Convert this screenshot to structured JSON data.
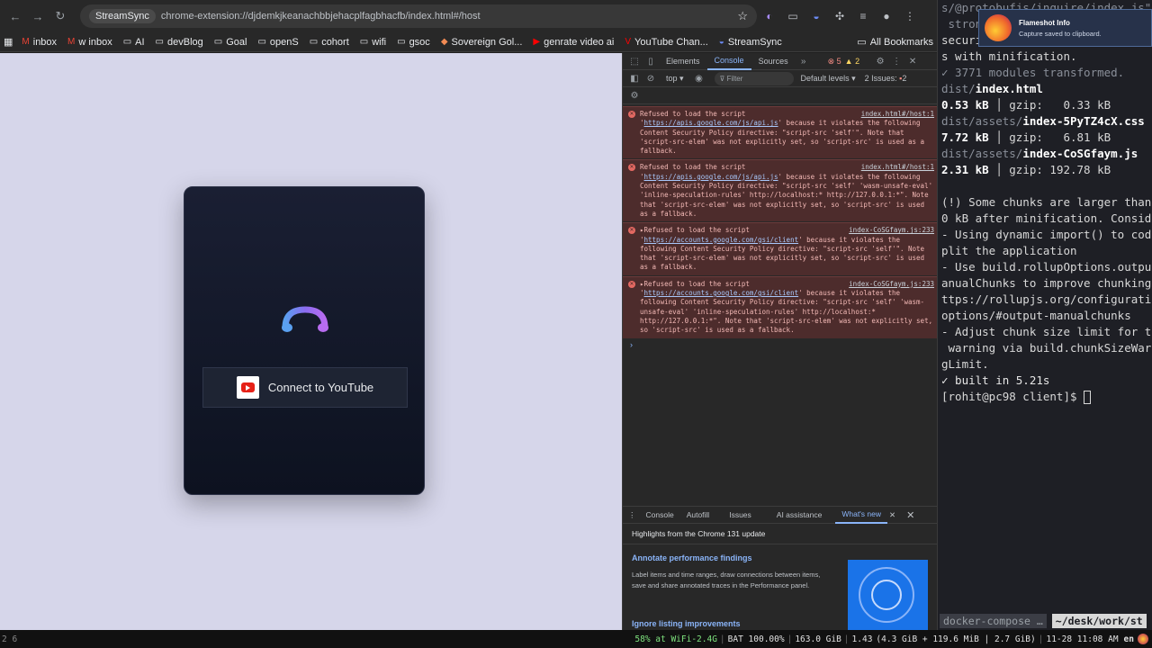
{
  "browser": {
    "tab_chip": "StreamSync",
    "url": "chrome-extension://djdemkjkeanachbbjehacplfagbhacfb/index.html#/host",
    "bookmarks": [
      {
        "icon": "gmail-icon",
        "label": "inbox"
      },
      {
        "icon": "gmail-icon",
        "label": "w inbox"
      },
      {
        "icon": "folder-icon",
        "label": "AI"
      },
      {
        "icon": "folder-icon",
        "label": "devBlog"
      },
      {
        "icon": "folder-icon",
        "label": "Goal"
      },
      {
        "icon": "folder-icon",
        "label": "openS"
      },
      {
        "icon": "folder-icon",
        "label": "cohort"
      },
      {
        "icon": "folder-icon",
        "label": "wifi"
      },
      {
        "icon": "folder-icon",
        "label": "gsoc"
      },
      {
        "icon": "sovereign-icon",
        "label": "Sovereign Gol..."
      },
      {
        "icon": "youtube-icon",
        "label": "genrate video ai"
      },
      {
        "icon": "youtube-icon",
        "label": "YouTube Chan..."
      },
      {
        "icon": "streamsync-icon",
        "label": "StreamSync"
      }
    ],
    "all_bookmarks": "All Bookmarks"
  },
  "app": {
    "connect_label": "Connect to YouTube",
    "page_bg": "#d6d6ea"
  },
  "devtools": {
    "tabs": [
      "Elements",
      "Console",
      "Sources"
    ],
    "active_tab": "Console",
    "error_count": "5",
    "warn_count": "2",
    "context": "top",
    "filter_placeholder": "Filter",
    "levels": "Default levels",
    "issues": "2 Issues:",
    "issues_count": "2",
    "errors": [
      {
        "src": "index.html#/host:1",
        "pre": "Refused to load the script '",
        "link": "https://apis.google.com/js/api.js",
        "post": "' because it violates the following Content Security Policy directive: \"script-src 'self'\". Note that 'script-src-elem' was not explicitly set, so 'script-src' is used as a fallback."
      },
      {
        "src": "index.html#/host:1",
        "pre": "Refused to load the script '",
        "link": "https://apis.google.com/js/api.js",
        "post": "' because it violates the following Content Security Policy directive: \"script-src 'self' 'wasm-unsafe-eval' 'inline-speculation-rules' http://localhost:* http://127.0.0.1:*\". Note that 'script-src-elem' was not explicitly set, so 'script-src' is used as a fallback."
      },
      {
        "src": "index-CoSGfaym.js:233",
        "pre": "▸Refused to load the script '",
        "link": "https://accounts.google.com/gsi/client",
        "post": "' because it violates the following Content Security Policy directive: \"script-src 'self'\". Note that 'script-src-elem' was not explicitly set, so 'script-src' is used as a fallback."
      },
      {
        "src": "index-CoSGfaym.js:233",
        "pre": "▸Refused to load the script '",
        "link": "https://accounts.google.com/gsi/client",
        "post": "' because it violates the following Content Security Policy directive: \"script-src 'self' 'wasm-unsafe-eval' 'inline-speculation-rules' http://localhost:* http://127.0.0.1:*\". Note that 'script-src-elem' was not explicitly set, so 'script-src' is used as a fallback."
      }
    ],
    "drawer_tabs": [
      "Console",
      "Autofill",
      "Issues",
      "AI assistance",
      "What's new"
    ],
    "drawer_active": "What's new",
    "whats_new_head": "Highlights from the Chrome 131 update",
    "whats_new_title": "Annotate performance findings",
    "whats_new_desc": "Label items and time ranges, draw connections between items, save and share annotated traces in the Performance panel.",
    "whats_new_title2": "Ignore listing improvements"
  },
  "terminal": {
    "lines": [
      {
        "t": "s/@protobufjs/inquire/index.js\"",
        "cls": "dim"
      },
      {
        "t": " strongly recommended to avoid",
        "cls": "dim"
      },
      {
        "t": "security risks and problems",
        "cls": ""
      },
      {
        "t": "s with minification.",
        "cls": ""
      },
      {
        "t": "✓ 3771 modules transformed.",
        "cls": "dim"
      },
      {
        "t": "dist/index.html",
        "cls": "file"
      },
      {
        "t": "0.53 kB │ gzip:   0.33 kB",
        "cls": "size"
      },
      {
        "t": "dist/assets/index-5PyTZ4cX.css",
        "cls": "file"
      },
      {
        "t": "7.72 kB │ gzip:   6.81 kB",
        "cls": "size"
      },
      {
        "t": "dist/assets/index-CoSGfaym.js",
        "cls": "file"
      },
      {
        "t": "2.31 kB │ gzip: 192.78 kB",
        "cls": "size"
      },
      {
        "t": "",
        "cls": ""
      },
      {
        "t": "(!) Some chunks are larger than",
        "cls": ""
      },
      {
        "t": "0 kB after minification. Consid",
        "cls": ""
      },
      {
        "t": "- Using dynamic import() to cod",
        "cls": ""
      },
      {
        "t": "plit the application",
        "cls": ""
      },
      {
        "t": "- Use build.rollupOptions.outpu",
        "cls": ""
      },
      {
        "t": "anualChunks to improve chunking",
        "cls": ""
      },
      {
        "t": "ttps://rollupjs.org/configurati",
        "cls": ""
      },
      {
        "t": "options/#output-manualchunks",
        "cls": ""
      },
      {
        "t": "- Adjust chunk size limit for t",
        "cls": ""
      },
      {
        "t": " warning via build.chunkSizeWar",
        "cls": ""
      },
      {
        "t": "gLimit.",
        "cls": ""
      },
      {
        "t": "✓ built in 5.21s",
        "cls": "ok"
      }
    ],
    "prompt": "[rohit@pc98 client]$ ",
    "pane1": "docker-compose …",
    "pane2": "~/desk/work/st"
  },
  "notification": {
    "title": "Flameshot Info",
    "body": "Capture saved to clipboard."
  },
  "statusbar": {
    "workspaces": "2 6",
    "wifi": "58% at WiFi-2.4G",
    "battery": "BAT 100.00%",
    "disk": "163.0 GiB",
    "load": "1.43",
    "mem": "(4.3 GiB + 119.6 MiB | 2.7 GiB)",
    "datetime": "11-28 11:08 AM",
    "lang": "en"
  }
}
